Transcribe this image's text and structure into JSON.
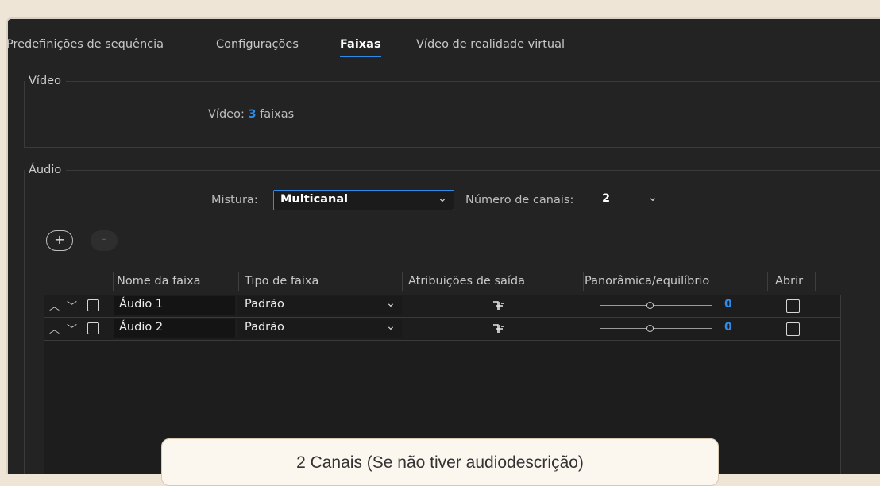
{
  "tabs": [
    {
      "label": "Predefinições de sequência"
    },
    {
      "label": "Configurações"
    },
    {
      "label": "Faixas"
    },
    {
      "label": "Vídeo de realidade virtual"
    }
  ],
  "video": {
    "legend": "Vídeo",
    "label": "Vídeo:",
    "count": "3",
    "unit": "faixas"
  },
  "audio": {
    "legend": "Áudio",
    "mix_label": "Mistura:",
    "mix_value": "Multicanal",
    "channels_label": "Número de canais:",
    "channels_value": "2",
    "add_button": "+",
    "remove_button": "-"
  },
  "table": {
    "headers": [
      "Nome da faixa",
      "Tipo de faixa",
      "Atribuições de saída",
      "Panorâmica/equilíbrio",
      "Abrir"
    ],
    "rows": [
      {
        "name": "Áudio 1",
        "type": "Padrão",
        "pan": "0",
        "pan_position": 0.5
      },
      {
        "name": "Áudio 2",
        "type": "Padrão",
        "pan": "0",
        "pan_position": 0.5
      }
    ]
  },
  "tooltip": {
    "text": "2 Canais (Se não tiver audiodescrição)"
  },
  "colors": {
    "accent": "#2d8ceb",
    "panel": "#232323",
    "page": "#efe5d6"
  }
}
